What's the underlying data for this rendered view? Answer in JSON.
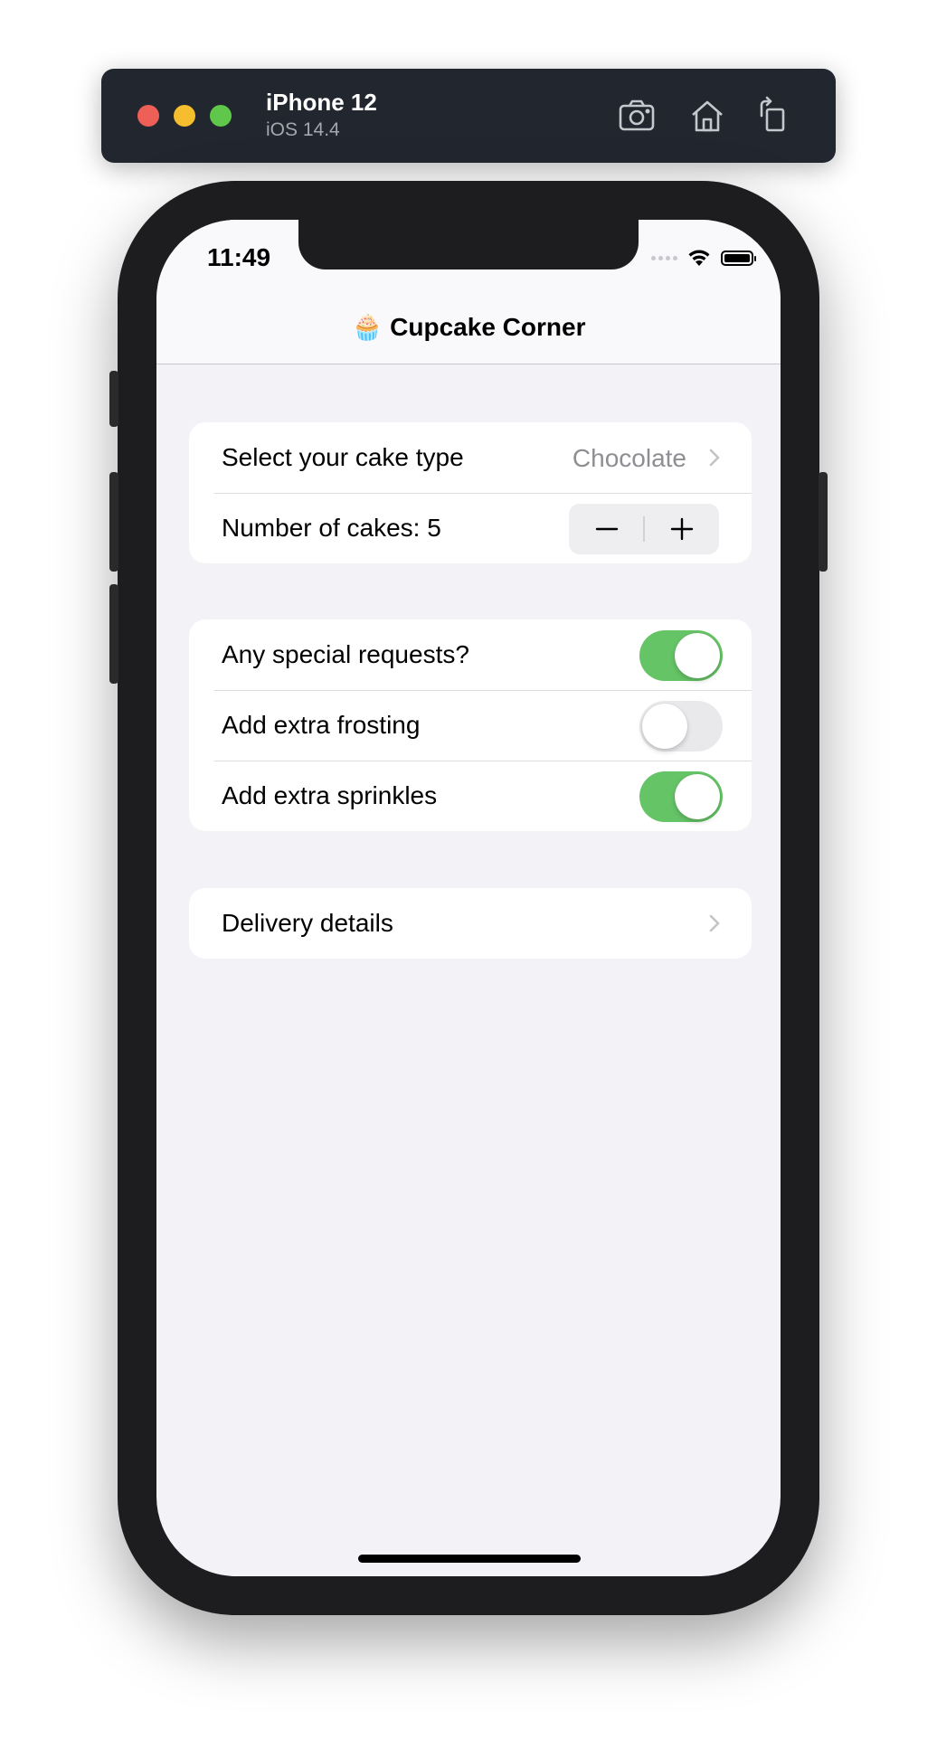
{
  "simulator": {
    "device_name": "iPhone 12",
    "os_version": "iOS 14.4",
    "toolbar": [
      "screenshot-icon",
      "home-icon",
      "rotate-icon"
    ]
  },
  "status_bar": {
    "time": "11:49"
  },
  "nav": {
    "title": "🧁 Cupcake Corner"
  },
  "order": {
    "cake_type_label": "Select your cake type",
    "cake_type_value": "Chocolate",
    "quantity_label": "Number of cakes: 5",
    "quantity": 5
  },
  "options": [
    {
      "label": "Any special requests?",
      "on": true
    },
    {
      "label": "Add extra frosting",
      "on": false
    },
    {
      "label": "Add extra sprinkles",
      "on": true
    }
  ],
  "delivery": {
    "label": "Delivery details"
  },
  "colors": {
    "toggle_on": "#65c466",
    "toggle_off": "#e9e9eb",
    "background": "#f2f2f7"
  }
}
